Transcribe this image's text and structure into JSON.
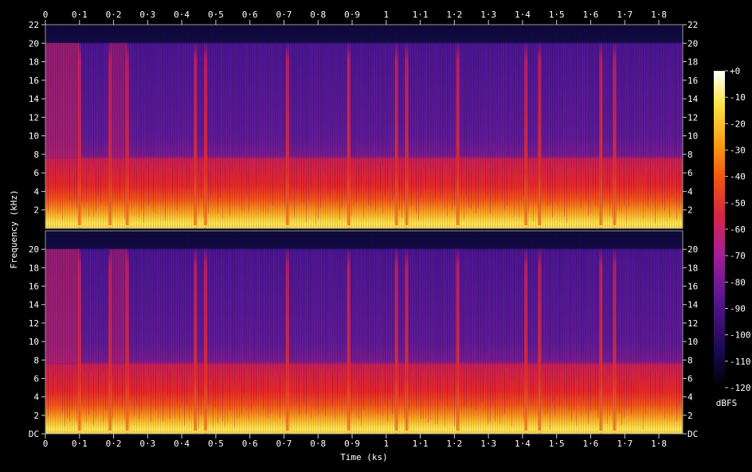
{
  "chart_data": {
    "type": "heatmap",
    "title": "",
    "xlabel": "Time (ks)",
    "ylabel": "Frequency (kHz)",
    "xlim": [
      0,
      1.87
    ],
    "ylim": [
      0,
      22
    ],
    "x_ticks": [
      "0",
      "0·1",
      "0·2",
      "0·3",
      "0·4",
      "0·5",
      "0·6",
      "0·7",
      "0·8",
      "0·9",
      "1",
      "1·1",
      "1·2",
      "1·3",
      "1·4",
      "1·5",
      "1·6",
      "1·7",
      "1·8"
    ],
    "y_ticks_top": [
      "2",
      "4",
      "6",
      "8",
      "10",
      "12",
      "14",
      "16",
      "18",
      "20",
      "22"
    ],
    "y_ticks_bottom": [
      "DC",
      "2",
      "4",
      "6",
      "8",
      "10",
      "12",
      "14",
      "16",
      "18",
      "20"
    ],
    "channels": [
      "channel 1",
      "channel 2"
    ],
    "colorbar": {
      "label": "dBFS",
      "ticks": [
        "+0",
        "-10",
        "-20",
        "-30",
        "-40",
        "-50",
        "-60",
        "-70",
        "-80",
        "-90",
        "-100",
        "-110",
        "-120"
      ],
      "range": [
        -120,
        0
      ],
      "colors": [
        "#000000",
        "#1a0a52",
        "#5a1590",
        "#a51f9a",
        "#d8263f",
        "#f25a0d",
        "#fca316",
        "#fde54a",
        "#ffffff"
      ]
    },
    "segment_boundaries_ks": [
      0.1,
      0.19,
      0.24,
      0.44,
      0.47,
      0.71,
      0.89,
      1.03,
      1.06,
      1.21,
      1.41,
      1.45,
      1.63,
      1.67
    ],
    "approx_levels": {
      "above_20kHz": -105,
      "8_to_20kHz": -75,
      "4_to_8kHz": -55,
      "2_to_4kHz": -40,
      "below_2kHz": -20
    }
  }
}
